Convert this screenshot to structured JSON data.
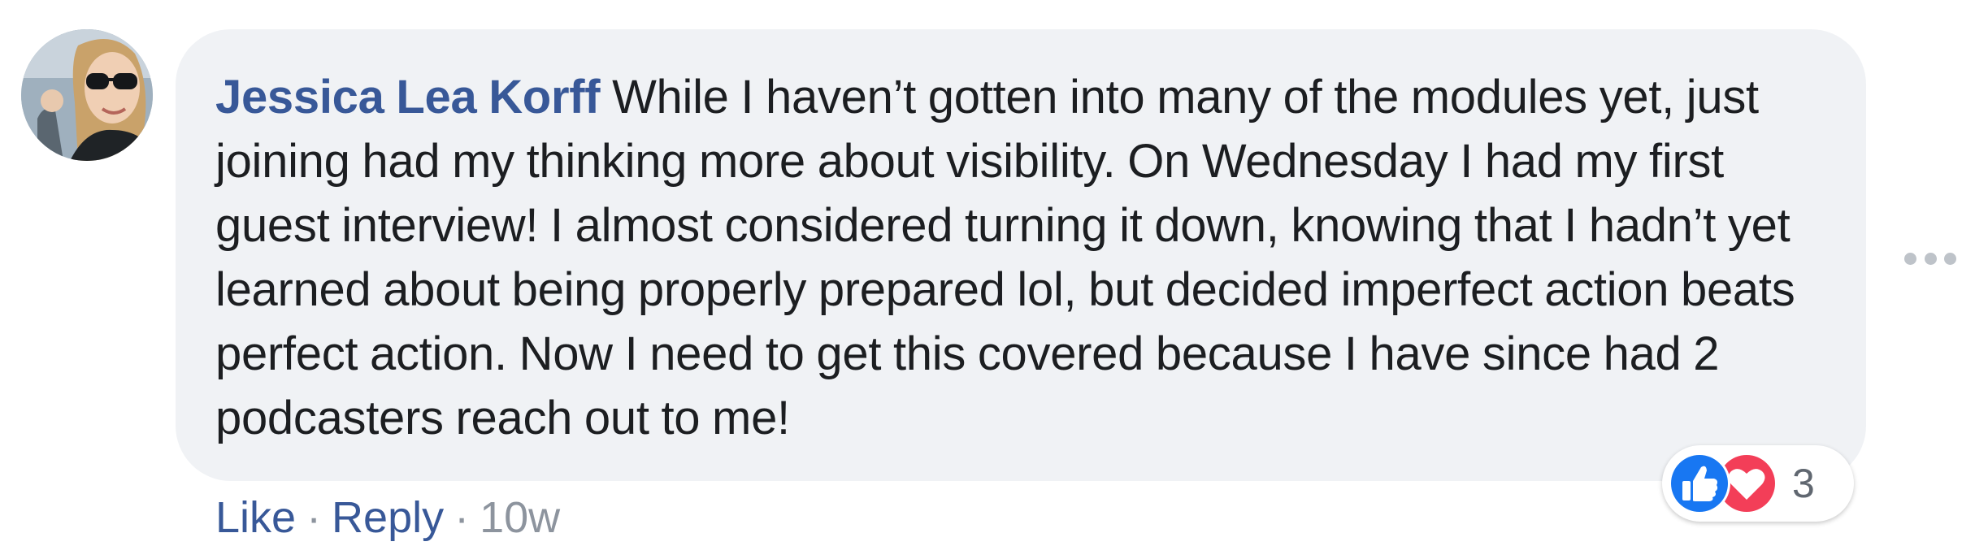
{
  "comment": {
    "author": "Jessica Lea Korff",
    "text": "While I haven’t gotten into many of the modules yet, just joining had my thinking more about visibility. On Wednesday I had my first guest interview! I almost considered turning it down, knowing that I hadn’t yet learned about being properly prepared lol, but decided imperfect action beats perfect action. Now I need to get this covered because I have since had 2 podcasters reach out to me!"
  },
  "actions": {
    "like_label": "Like",
    "separator": "·",
    "reply_label": "Reply",
    "timestamp": "10w"
  },
  "reactions": {
    "count": "3",
    "icons": [
      "like-icon",
      "love-icon"
    ]
  },
  "icons": {
    "more": "more-options-icon"
  },
  "colors": {
    "author": "#385898",
    "bubble_bg": "#f0f2f5",
    "text": "#1c1e21",
    "meta": "#8d949e",
    "like_blue": "#1877f2",
    "love_red": "#f33e58"
  }
}
